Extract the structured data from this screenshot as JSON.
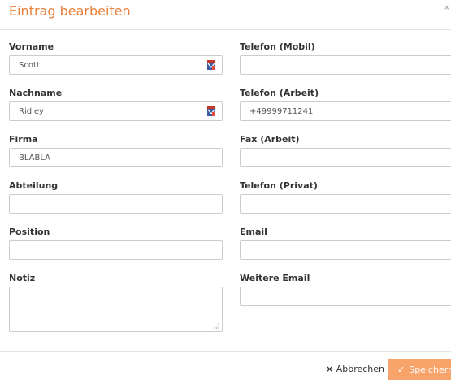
{
  "dialog": {
    "title": "Eintrag bearbeiten",
    "close_glyph": "×"
  },
  "fields": {
    "vorname": {
      "label": "Vorname",
      "value": "Scott"
    },
    "nachname": {
      "label": "Nachname",
      "value": "Ridley"
    },
    "firma": {
      "label": "Firma",
      "value": "BLABLA"
    },
    "abteilung": {
      "label": "Abteilung",
      "value": ""
    },
    "position": {
      "label": "Position",
      "value": ""
    },
    "notiz": {
      "label": "Notiz",
      "value": ""
    },
    "telefon_mobil": {
      "label": "Telefon (Mobil)",
      "value": ""
    },
    "telefon_arbeit": {
      "label": "Telefon (Arbeit)",
      "value": "+49999711241"
    },
    "fax_arbeit": {
      "label": "Fax (Arbeit)",
      "value": ""
    },
    "telefon_privat": {
      "label": "Telefon (Privat)",
      "value": ""
    },
    "email": {
      "label": "Email",
      "value": ""
    },
    "weitere_email": {
      "label": "Weitere Email",
      "value": ""
    }
  },
  "footer": {
    "cancel_label": "Abbrechen",
    "cancel_icon": "×",
    "save_label": "Speichern",
    "save_icon": "✓"
  },
  "colors": {
    "accent": "#e8803a",
    "save_button": "#f7a36a"
  }
}
